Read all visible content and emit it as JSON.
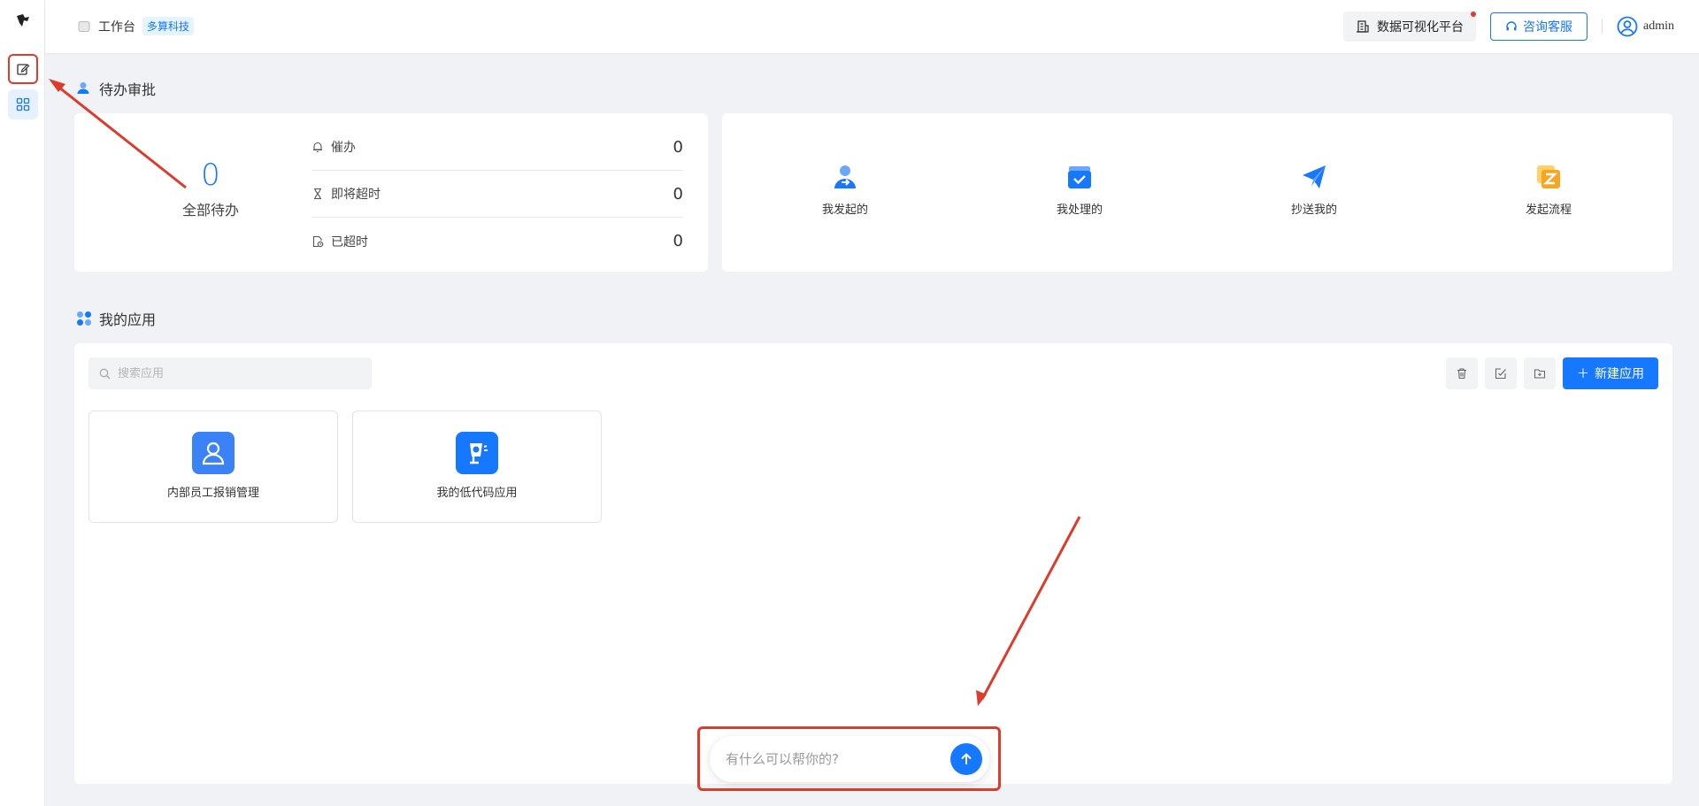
{
  "header": {
    "workspace_label": "工作台",
    "org_tag": "多算科技",
    "platform_button": "数据可视化平台",
    "service_button": "咨询客服",
    "username": "admin"
  },
  "todo": {
    "section_title": "待办审批",
    "total_count": "0",
    "total_label": "全部待办",
    "rows": [
      {
        "label": "催办",
        "value": "0"
      },
      {
        "label": "即将超时",
        "value": "0"
      },
      {
        "label": "已超时",
        "value": "0"
      }
    ]
  },
  "quick": {
    "items": [
      {
        "label": "我发起的"
      },
      {
        "label": "我处理的"
      },
      {
        "label": "抄送我的"
      },
      {
        "label": "发起流程"
      }
    ]
  },
  "apps": {
    "section_title": "我的应用",
    "search_placeholder": "搜索应用",
    "new_button": "新建应用",
    "items": [
      {
        "name": "内部员工报销管理"
      },
      {
        "name": "我的低代码应用"
      }
    ]
  },
  "chat": {
    "placeholder": "有什么可以帮你的?"
  },
  "colors": {
    "primary": "#1677ff",
    "annotation_red": "#e03a2b",
    "background": "#f0f2f5"
  }
}
